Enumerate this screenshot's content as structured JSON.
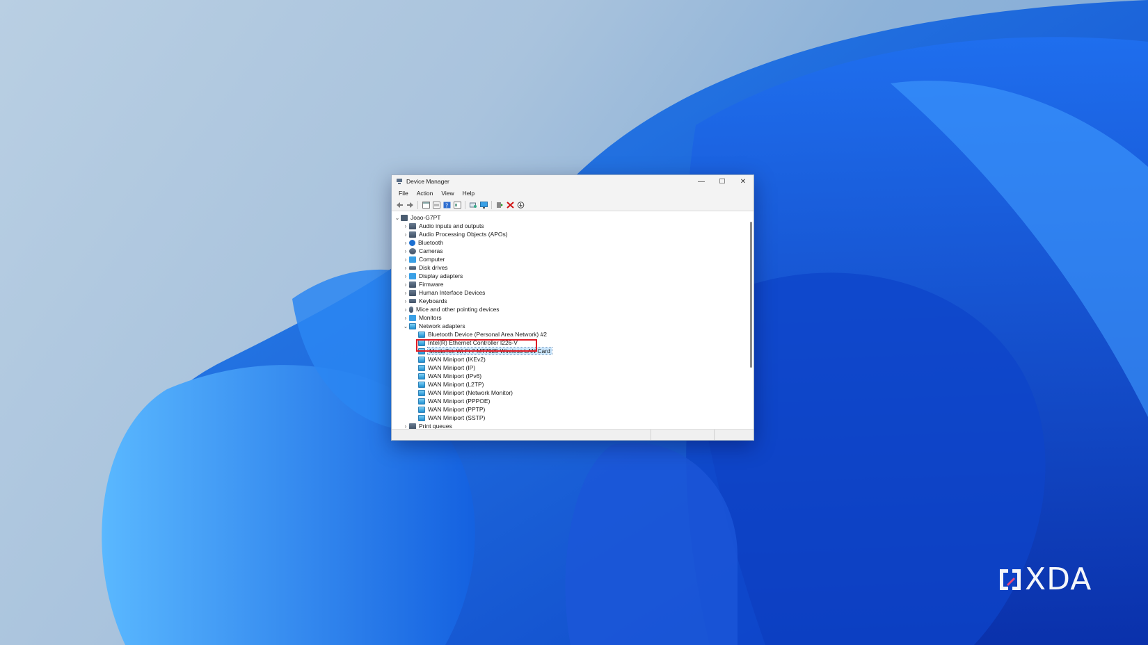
{
  "window": {
    "title": "Device Manager",
    "controls": {
      "minimize": "—",
      "maximize": "☐",
      "close": "✕"
    }
  },
  "menu": [
    "File",
    "Action",
    "View",
    "Help"
  ],
  "toolbar": {
    "icons": [
      "back-icon",
      "forward-icon",
      "show-hide-console-tree-icon",
      "properties-icon",
      "help-icon",
      "view-icon",
      "scan-hardware-icon",
      "monitor-icon",
      "update-driver-icon",
      "uninstall-icon",
      "download-icon"
    ]
  },
  "tree": {
    "root": "Joao-G7PT",
    "categories": [
      {
        "label": "Audio inputs and outputs",
        "icon": "speaker-icon"
      },
      {
        "label": "Audio Processing Objects (APOs)",
        "icon": "speaker-icon"
      },
      {
        "label": "Bluetooth",
        "icon": "bluetooth-icon"
      },
      {
        "label": "Cameras",
        "icon": "camera-icon"
      },
      {
        "label": "Computer",
        "icon": "computer-icon"
      },
      {
        "label": "Disk drives",
        "icon": "disk-icon"
      },
      {
        "label": "Display adapters",
        "icon": "display-adapter-icon"
      },
      {
        "label": "Firmware",
        "icon": "firmware-icon"
      },
      {
        "label": "Human Interface Devices",
        "icon": "hid-icon"
      },
      {
        "label": "Keyboards",
        "icon": "keyboard-icon"
      },
      {
        "label": "Mice and other pointing devices",
        "icon": "mouse-icon"
      },
      {
        "label": "Monitors",
        "icon": "monitor-icon"
      }
    ],
    "expanded": {
      "label": "Network adapters",
      "children": [
        "Bluetooth Device (Personal Area Network) #2",
        "Intel(R) Ethernet Controller I226-V",
        "MediaTek Wi-Fi 7 MT7925 Wireless LAN Card",
        "WAN Miniport (IKEv2)",
        "WAN Miniport (IP)",
        "WAN Miniport (IPv6)",
        "WAN Miniport (L2TP)",
        "WAN Miniport (Network Monitor)",
        "WAN Miniport (PPPOE)",
        "WAN Miniport (PPTP)",
        "WAN Miniport (SSTP)"
      ],
      "selected_index": 2
    },
    "after": "Print queues"
  },
  "watermark": {
    "brand": "XDA"
  },
  "colors": {
    "highlight": "#e01b24",
    "selection": "#cce8ff"
  }
}
